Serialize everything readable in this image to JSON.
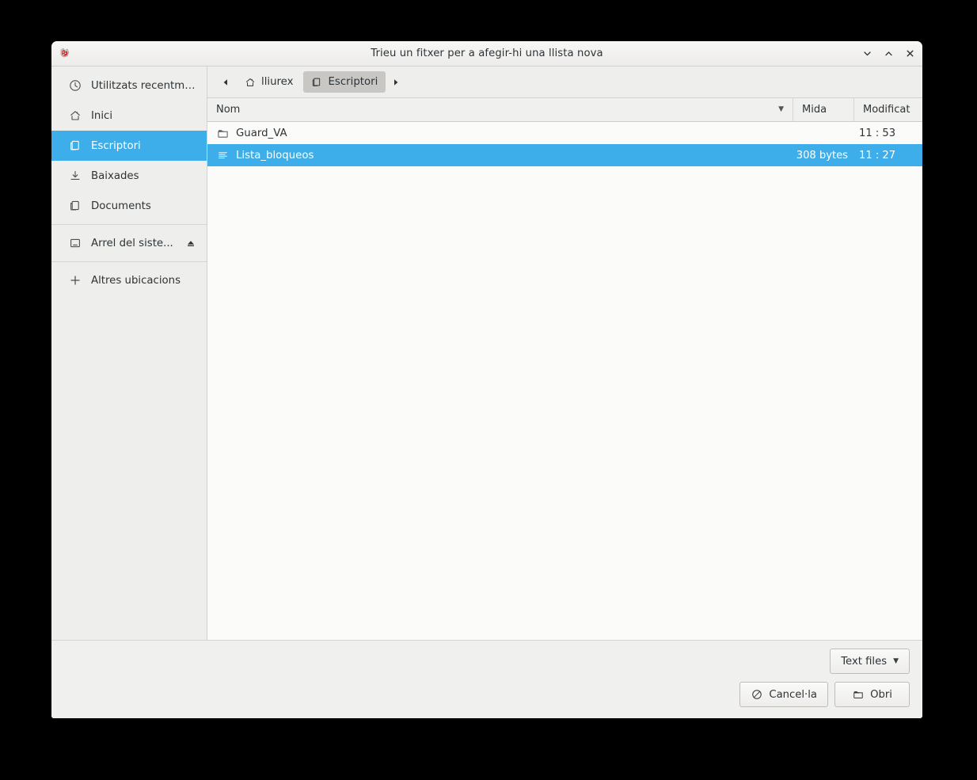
{
  "window": {
    "title": "Trieu un fitxer per a afegir-hi una llista nova",
    "app_icon": "lliurex-app-icon",
    "controls": [
      {
        "name": "minimize-button",
        "icon": "chevron-down-icon"
      },
      {
        "name": "maximize-button",
        "icon": "chevron-up-icon"
      },
      {
        "name": "close-button",
        "icon": "close-x-icon"
      }
    ]
  },
  "sidebar": {
    "items": [
      {
        "label": "Utilitzats recentment",
        "icon": "clock-icon",
        "selected": false
      },
      {
        "label": "Inici",
        "icon": "home-icon",
        "selected": false
      },
      {
        "label": "Escriptori",
        "icon": "desktop-icon",
        "selected": true
      },
      {
        "label": "Baixades",
        "icon": "download-icon",
        "selected": false
      },
      {
        "label": "Documents",
        "icon": "documents-icon",
        "selected": false
      },
      {
        "label": "Arrel del siste...",
        "icon": "drive-icon",
        "selected": false,
        "eject": "eject-icon"
      },
      {
        "label": "Altres ubicacions",
        "icon": "plus-icon",
        "selected": false
      }
    ]
  },
  "pathbar": {
    "back_icon": "triangle-left-icon",
    "forward_icon": "triangle-right-icon",
    "crumbs": [
      {
        "label": "lliurex",
        "icon": "home-icon",
        "active": false
      },
      {
        "label": "Escriptori",
        "icon": "desktop-icon",
        "active": true
      }
    ]
  },
  "columns": {
    "name": "Nom",
    "size": "Mida",
    "modified": "Modificat",
    "sort_caret": "▼"
  },
  "files": [
    {
      "name": "Guard_VA",
      "icon": "folder-icon",
      "size": "",
      "modified": "11 : 53",
      "selected": false
    },
    {
      "name": "Lista_bloqueos",
      "icon": "text-file-icon",
      "size": "308 bytes",
      "modified": "11 : 27",
      "selected": true
    }
  ],
  "footer": {
    "filter_label": "Text files",
    "filter_caret": "▼",
    "cancel_label": "Cancel·la",
    "cancel_icon": "no-entry-icon",
    "open_label": "Obri",
    "open_icon": "folder-open-icon"
  },
  "colors": {
    "accent": "#3daee9",
    "window_bg": "#f0f0ef",
    "sidebar_bg": "#eeeeec",
    "list_bg": "#fbfbfa",
    "text": "#2e3436",
    "border": "#d5d2cd"
  }
}
